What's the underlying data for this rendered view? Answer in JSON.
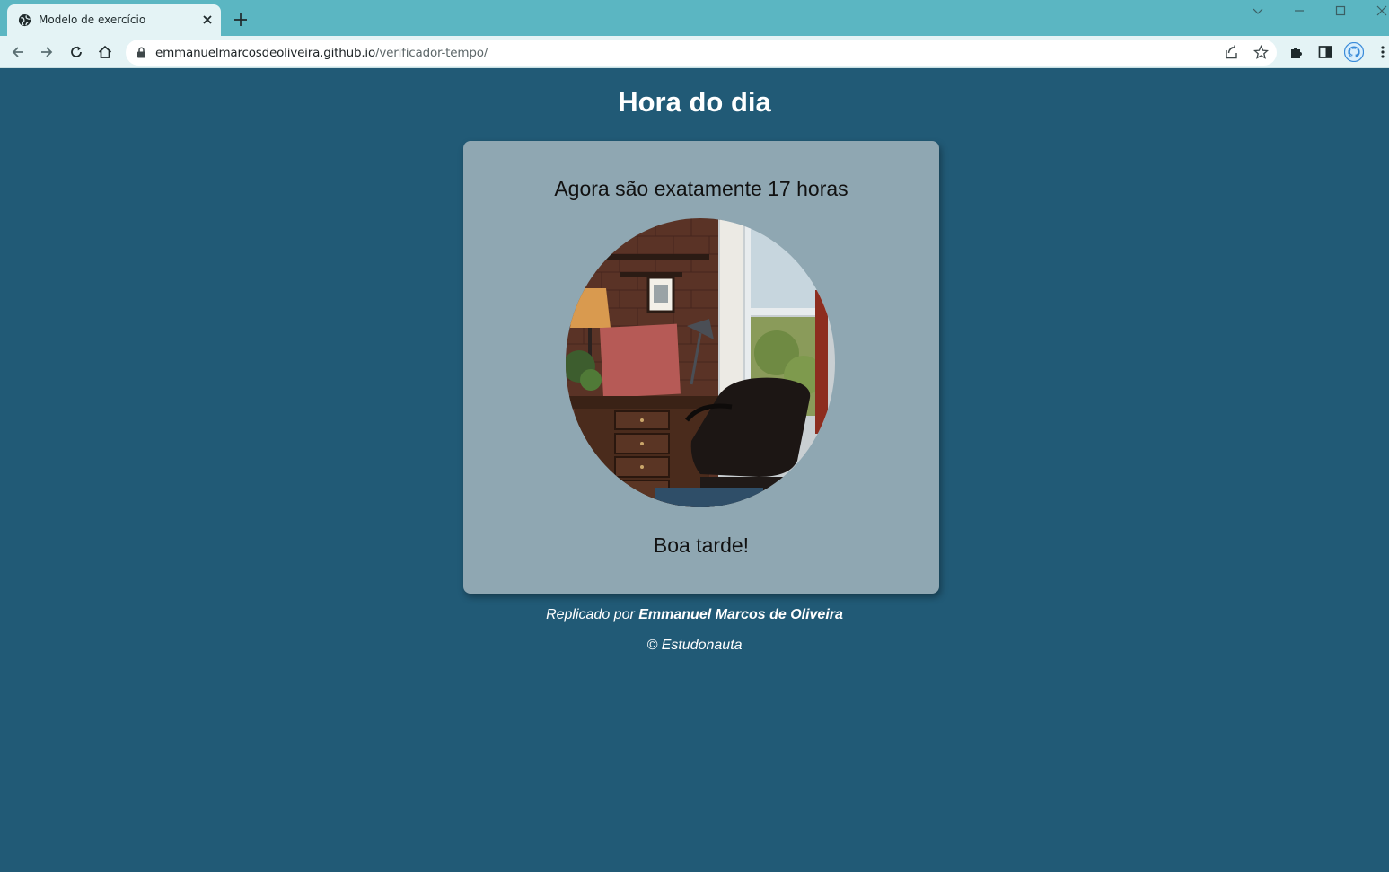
{
  "browser": {
    "tab_title": "Modelo de exercício",
    "url_host": "emmanuelmarcosdeoliveira.github.io",
    "url_path": "/verificador-tempo/",
    "accent_color": "#5bb6c2"
  },
  "page": {
    "title": "Hora do dia",
    "hour_message": "Agora são exatamente 17 horas",
    "greeting": "Boa tarde!",
    "credit_prefix": "Replicado por ",
    "credit_author": "Emmanuel Marcos de Oliveira",
    "copyright": "© Estudonauta",
    "background_color": "#215a76",
    "card_color": "#8fa7b2"
  },
  "icons": {
    "tab_favicon": "globe-icon",
    "tab_close": "close-icon",
    "new_tab": "plus-icon",
    "back": "arrow-left-icon",
    "forward": "arrow-right-icon",
    "reload": "reload-icon",
    "home": "home-icon",
    "lock": "lock-icon",
    "share": "share-icon",
    "bookmark": "star-icon",
    "extensions": "puzzle-icon",
    "side_panel": "side-panel-icon",
    "profile": "github-avatar-icon",
    "menu": "kebab-menu-icon"
  }
}
